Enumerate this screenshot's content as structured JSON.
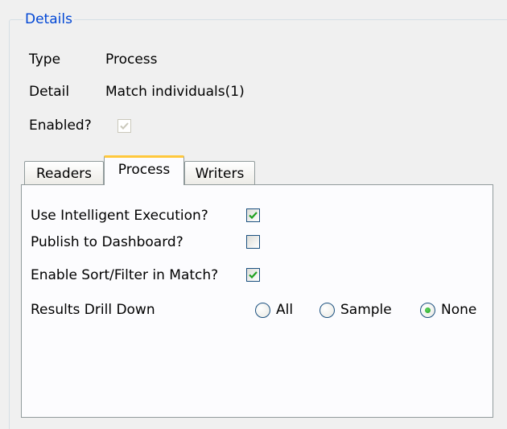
{
  "group_title": "Details",
  "properties": {
    "type_label": "Type",
    "type_value": "Process",
    "detail_label": "Detail",
    "detail_value": "Match individuals(1)",
    "enabled_label": "Enabled?",
    "enabled_checked": true
  },
  "tabs": [
    {
      "label": "Readers",
      "active": false
    },
    {
      "label": "Process",
      "active": true
    },
    {
      "label": "Writers",
      "active": false
    }
  ],
  "process_tab": {
    "intelligent_execution": {
      "label": "Use Intelligent Execution?",
      "checked": true
    },
    "publish_dashboard": {
      "label": "Publish to Dashboard?",
      "checked": false
    },
    "sort_filter": {
      "label": "Enable Sort/Filter in Match?",
      "checked": true
    },
    "drill_down": {
      "label": "Results Drill Down",
      "options": [
        "All",
        "Sample",
        "None"
      ],
      "selected": "None"
    }
  },
  "colors": {
    "group_title": "#0046d5",
    "active_tab_accent": "#ffc83c",
    "check_mark": "#21a121"
  }
}
